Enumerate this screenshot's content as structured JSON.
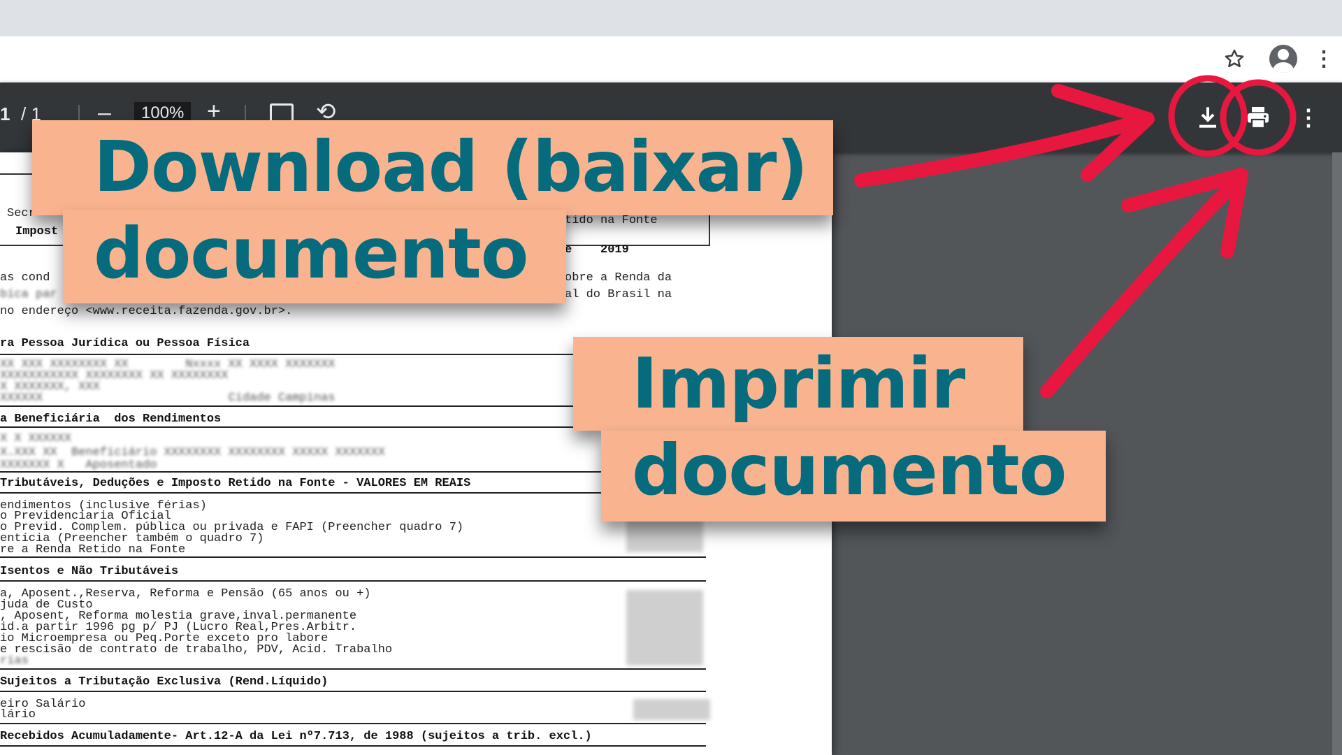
{
  "browser": {
    "icons": [
      "star-icon",
      "account-icon",
      "kebab-menu-icon"
    ],
    "kebab": "⋮"
  },
  "pdf_toolbar": {
    "page_current": "1",
    "page_total": "/ 1",
    "zoom_out": "–",
    "zoom_value": "100%",
    "zoom_in": "+",
    "rotate": "⟲",
    "more": "⋮",
    "icons": [
      "download-icon",
      "print-icon",
      "fit-to-page-icon",
      "rotate-icon"
    ]
  },
  "document": {
    "header_left_1": "Secr",
    "header_left_2": "Impost",
    "header_right_1": "tido na Fonte",
    "header_right_2": "e    2019",
    "intro_1": "as cond",
    "intro_1_right": "obre a Renda da",
    "intro_2": "bica par",
    "intro_2_right": "al do Brasil na",
    "intro_3": "no endereço <www.receita.fazenda.gov.br>.",
    "section1": "ra Pessoa Jurídica ou Pessoa Física",
    "section1_blur_1": "XX XXX XXXXXXXX XX        Nxxxx XX XXXX XXXXXXX",
    "section1_blur_2": "XXXXXXXXXXX XXXXXXXX XX XXXXXXXX",
    "section1_blur_3": "X XXXXXXX, XXX",
    "section1_blur_4": "XXXXXX                          Cidade Campinas",
    "section2": "a Beneficiária  dos Rendimentos",
    "section2_blur_1": "X X XXXXXX",
    "section2_blur_2": "X.XXX XX  Beneficiário XXXXXXXX XXXXXXXX XXXXX XXXXXXX",
    "section2_blur_3": "XXXXXXX X   Aposentado",
    "section3": "Tributáveis, Deduções e Imposto Retido na Fonte - VALORES EM REAIS",
    "s3_line1": "endimentos (inclusive férias)",
    "s3_line2": "o Previdenciaria Oficial",
    "s3_line3": "o Previd. Complem. pública ou privada e FAPI (Preencher quadro 7)",
    "s3_line4": "entícia (Preencher também o quadro 7)",
    "s3_line5": "re a Renda Retido na Fonte",
    "section4": "Isentos e Não Tributáveis",
    "s4_line1": "a, Aposent.,Reserva, Reforma e Pensão (65 anos ou +)",
    "s4_line2": "juda de Custo",
    "s4_line3": ", Aposent, Reforma molestia grave,inval.permanente",
    "s4_line4": "id.a partir 1996 pg p/ PJ (Lucro Real,Pres.Arbitr.",
    "s4_line5": "io Microempresa ou Peq.Porte exceto pro labore",
    "s4_line6": "e rescisão de contrato de trabalho, PDV, Acid. Trabalho",
    "s4_line7": "rias",
    "section5": "Sujeitos a Tributação Exclusiva (Rend.Líquido)",
    "s5_line1": "eiro Salário",
    "s5_line2": "lário",
    "section6": "Recebidos Acumuladamente- Art.12-A da Lei nº7.713, de 1988 (sujeitos a trib. excl.)"
  },
  "callouts": {
    "download_line1": "Download (baixar)",
    "download_line2": "documento",
    "print_line1": "Imprimir",
    "print_line2": "documento",
    "callout_bg": "#f9b48f",
    "callout_text": "#066b7d",
    "arrow_color": "#e8173f"
  }
}
